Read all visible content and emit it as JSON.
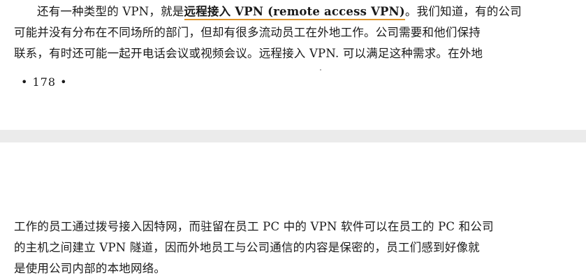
{
  "top_page": {
    "lines": [
      {
        "before": "还有一种类型的 VPN，就是",
        "highlight": "远程接入 VPN (remote access VPN)",
        "after": "。我们知道，有的公司"
      },
      {
        "text": "可能并没有分布在不同场所的部门，但却有很多流动员工在外地工作。公司需要和他们保持"
      },
      {
        "text": "联系，有时还可能一起开电话会议或视频会议。远程接入 VPN. 可以满足这种需求。在外地"
      }
    ],
    "page_number": "• 178 •"
  },
  "bottom_page": {
    "lines": [
      "工作的员工通过拨号接入因特网，而驻留在员工 PC 中的 VPN 软件可以在员工的 PC 和公司",
      "的主机之间建立 VPN 隧道，因而外地员工与公司通信的内容是保密的，员工们感到好像就",
      "是使用公司内部的本地网络。"
    ]
  },
  "colors": {
    "underline": "#e0952a",
    "gap": "#ebebeb"
  }
}
